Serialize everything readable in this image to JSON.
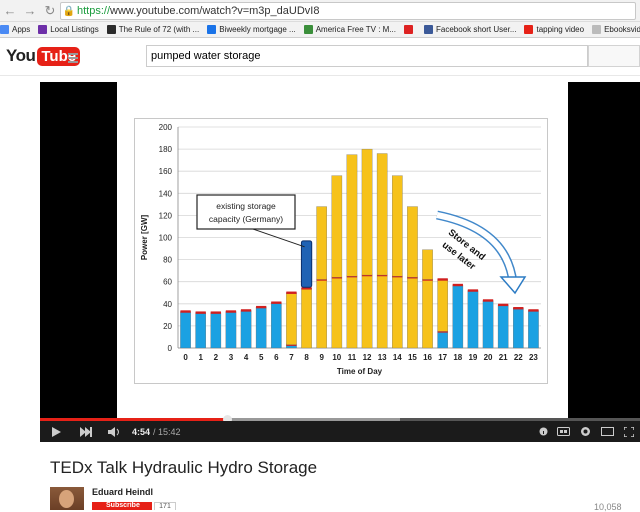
{
  "browser": {
    "url_https": "https://",
    "url_rest": "www.youtube.com/watch?v=m3p_daUDvI8",
    "bookmarks": [
      {
        "label": "Apps",
        "color": "#4a8af4"
      },
      {
        "label": "Local Listings",
        "color": "#6d2fa8"
      },
      {
        "label": "The Rule of 72 (with ...",
        "color": "#2b2b2b"
      },
      {
        "label": "Biweekly mortgage ...",
        "color": "#1a73e8"
      },
      {
        "label": "America Free TV : M...",
        "color": "#3b8f3b"
      },
      {
        "label": "",
        "color": "#d22"
      },
      {
        "label": "Facebook short User...",
        "color": "#3b5998"
      },
      {
        "label": "tapping video",
        "color": "#e62117"
      },
      {
        "label": "Ebooksvideos",
        "color": "#bbb"
      }
    ]
  },
  "youtube": {
    "logo_you": "You",
    "logo_tube": "Tube",
    "search_query": "pumped water storage"
  },
  "player": {
    "time_current": "4:54",
    "time_total": "/ 15:42",
    "progress_played": 0.312,
    "progress_buffered": 0.6
  },
  "video": {
    "title": "TEDx Talk Hydraulic Hydro Storage",
    "channel": "Eduard Heindl",
    "subscribe_label": "Subscribe",
    "subscriber_count": "171",
    "views_partial": "10,058"
  },
  "chart_data": {
    "type": "bar",
    "ylabel": "Power [GW]",
    "xlabel": "Time of Day",
    "ylim": [
      0,
      200
    ],
    "yticks": [
      0,
      20,
      40,
      60,
      80,
      100,
      120,
      140,
      160,
      180,
      200
    ],
    "categories": [
      "0",
      "1",
      "2",
      "3",
      "4",
      "5",
      "6",
      "7",
      "8",
      "9",
      "10",
      "11",
      "12",
      "13",
      "14",
      "15",
      "16",
      "17",
      "18",
      "19",
      "20",
      "21",
      "22",
      "23"
    ],
    "series": [
      {
        "values": [
          33,
          32,
          32,
          33,
          34,
          37,
          41,
          3,
          0,
          0,
          0,
          0,
          0,
          0,
          0,
          0,
          0,
          15,
          57,
          52,
          43,
          39,
          36,
          34
        ],
        "color": "#1ba1e2"
      },
      {
        "values": [
          0,
          0,
          0,
          0,
          0,
          0,
          0,
          47,
          54,
          62,
          64,
          65,
          66,
          66,
          65,
          64,
          62,
          47,
          0,
          0,
          0,
          0,
          0,
          0
        ],
        "color": "#f6c21a"
      },
      {
        "values": [
          0,
          0,
          0,
          0,
          0,
          0,
          0,
          0,
          0,
          66,
          92,
          110,
          114,
          110,
          91,
          64,
          27,
          0,
          0,
          0,
          0,
          0,
          0,
          0
        ],
        "color": "#f6c21a"
      }
    ],
    "red_cap_color": "#d02020",
    "storage_bar": {
      "category": "8",
      "low": 55,
      "high": 97,
      "color": "#1f62b4"
    },
    "annotations": [
      {
        "text": "existing storage",
        "line": 1
      },
      {
        "text": "capacity (Germany)",
        "line": 2
      },
      {
        "text": "Store and",
        "line": 1
      },
      {
        "text": "use later",
        "line": 2
      }
    ],
    "grid": true
  }
}
